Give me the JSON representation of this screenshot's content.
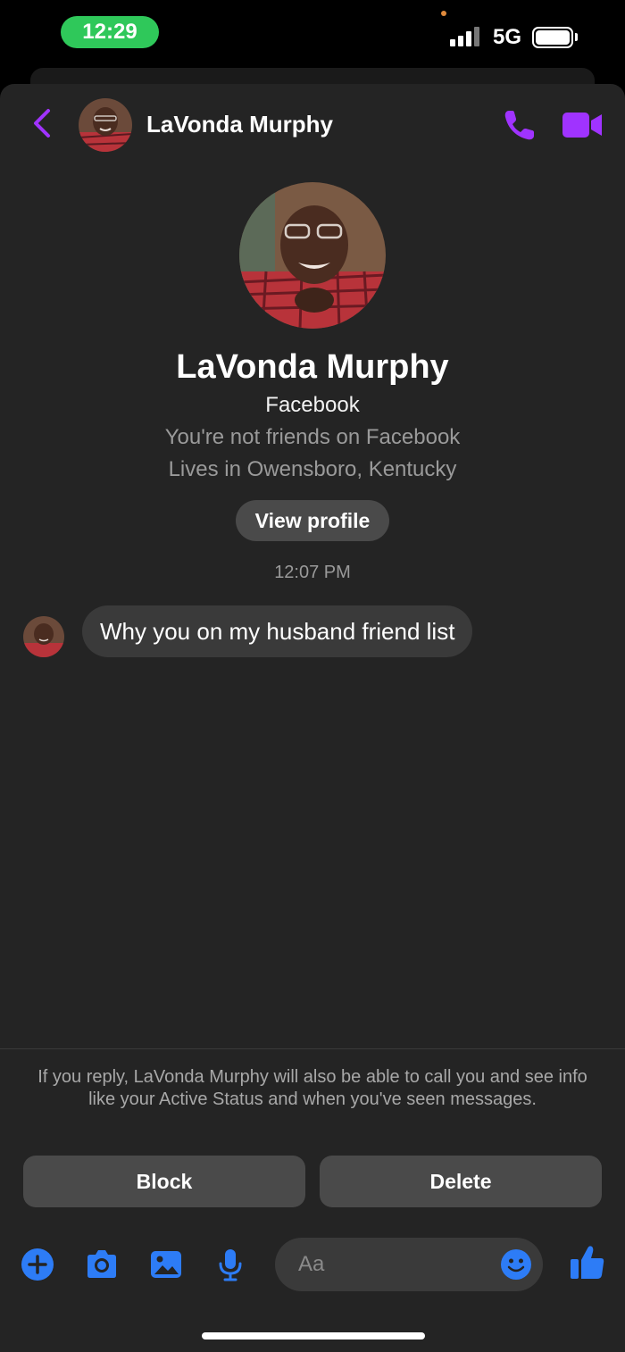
{
  "status_bar": {
    "time": "12:29",
    "network": "5G",
    "time_pill_color": "#2fc85a"
  },
  "header": {
    "contact_name": "LaVonda Murphy",
    "back_icon": "chevron-left-icon",
    "call_icon": "phone-icon",
    "video_icon": "video-camera-icon",
    "accent_color": "#a033ff"
  },
  "profile": {
    "name": "LaVonda Murphy",
    "source": "Facebook",
    "friend_status": "You're not friends on Facebook",
    "location": "Lives in Owensboro, Kentucky",
    "view_profile_label": "View profile"
  },
  "conversation": {
    "timestamp": "12:07 PM",
    "messages": [
      {
        "from": "LaVonda Murphy",
        "text": "Why you on my husband friend list"
      }
    ]
  },
  "request_notice": {
    "text": "If you reply, LaVonda Murphy will also be able to call you and see info like your Active Status and when you've seen messages."
  },
  "actions": {
    "block_label": "Block",
    "delete_label": "Delete"
  },
  "composer": {
    "placeholder": "Aa",
    "icons": [
      "plus-circle-icon",
      "camera-icon",
      "photo-icon",
      "microphone-icon",
      "emoji-icon",
      "thumbs-up-icon"
    ],
    "icon_color": "#2d7cf6"
  }
}
